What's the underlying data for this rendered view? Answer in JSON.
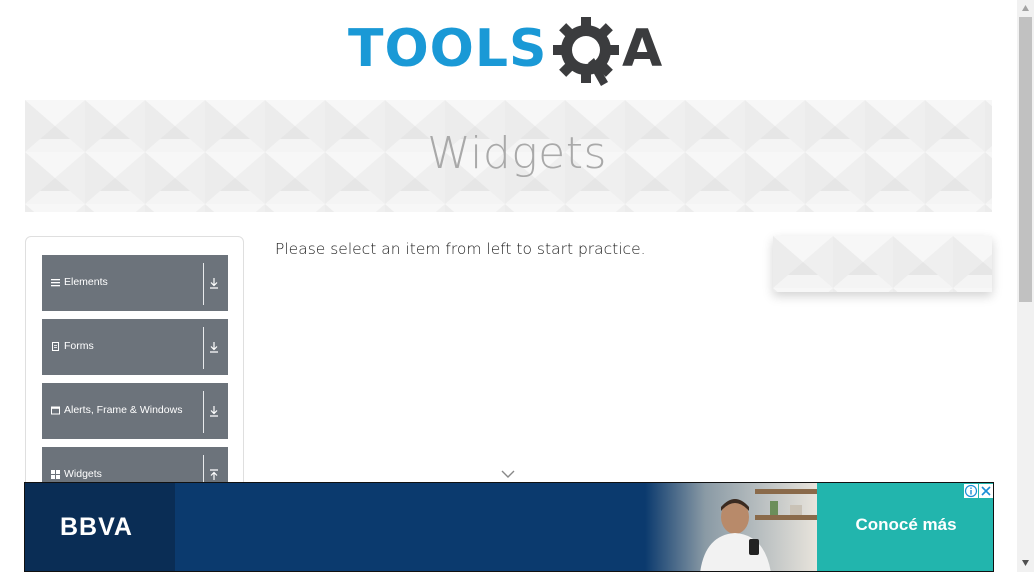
{
  "header": {
    "logo_text": "TOOLS",
    "logo_suffix": "A"
  },
  "banner": {
    "title": "Widgets"
  },
  "sidebar": {
    "groups": [
      {
        "label": "Elements",
        "icon": "hamburger-icon",
        "expanded": false
      },
      {
        "label": "Forms",
        "icon": "document-icon",
        "expanded": false
      },
      {
        "label": "Alerts, Frame & Windows",
        "icon": "window-icon",
        "expanded": false
      },
      {
        "label": "Widgets",
        "icon": "grid-icon",
        "expanded": true
      }
    ]
  },
  "main": {
    "instruction": "Please select an item from left to start practice."
  },
  "ad": {
    "brand": "BBVA",
    "cta": "Conocé más",
    "info_symbol": "i",
    "close_symbol": "✕"
  },
  "colors": {
    "logo_blue": "#1a99d6",
    "logo_dark": "#3b3c3e",
    "sidebar_group_bg": "#6c737b",
    "ad_navy": "#0b3a6e",
    "ad_teal": "#22b5ad"
  }
}
